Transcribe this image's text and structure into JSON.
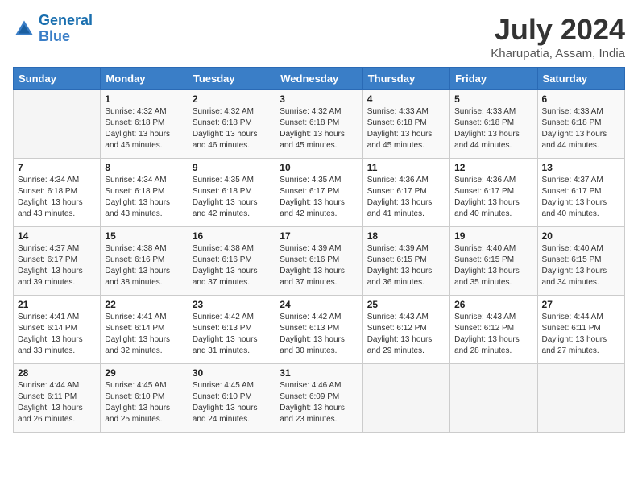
{
  "logo": {
    "line1": "General",
    "line2": "Blue"
  },
  "title": "July 2024",
  "location": "Kharupatia, Assam, India",
  "days_of_week": [
    "Sunday",
    "Monday",
    "Tuesday",
    "Wednesday",
    "Thursday",
    "Friday",
    "Saturday"
  ],
  "weeks": [
    [
      {
        "day": "",
        "sunrise": "",
        "sunset": "",
        "daylight": "",
        "empty": true
      },
      {
        "day": "1",
        "sunrise": "Sunrise: 4:32 AM",
        "sunset": "Sunset: 6:18 PM",
        "daylight": "Daylight: 13 hours and 46 minutes."
      },
      {
        "day": "2",
        "sunrise": "Sunrise: 4:32 AM",
        "sunset": "Sunset: 6:18 PM",
        "daylight": "Daylight: 13 hours and 46 minutes."
      },
      {
        "day": "3",
        "sunrise": "Sunrise: 4:32 AM",
        "sunset": "Sunset: 6:18 PM",
        "daylight": "Daylight: 13 hours and 45 minutes."
      },
      {
        "day": "4",
        "sunrise": "Sunrise: 4:33 AM",
        "sunset": "Sunset: 6:18 PM",
        "daylight": "Daylight: 13 hours and 45 minutes."
      },
      {
        "day": "5",
        "sunrise": "Sunrise: 4:33 AM",
        "sunset": "Sunset: 6:18 PM",
        "daylight": "Daylight: 13 hours and 44 minutes."
      },
      {
        "day": "6",
        "sunrise": "Sunrise: 4:33 AM",
        "sunset": "Sunset: 6:18 PM",
        "daylight": "Daylight: 13 hours and 44 minutes."
      }
    ],
    [
      {
        "day": "7",
        "sunrise": "Sunrise: 4:34 AM",
        "sunset": "Sunset: 6:18 PM",
        "daylight": "Daylight: 13 hours and 43 minutes."
      },
      {
        "day": "8",
        "sunrise": "Sunrise: 4:34 AM",
        "sunset": "Sunset: 6:18 PM",
        "daylight": "Daylight: 13 hours and 43 minutes."
      },
      {
        "day": "9",
        "sunrise": "Sunrise: 4:35 AM",
        "sunset": "Sunset: 6:18 PM",
        "daylight": "Daylight: 13 hours and 42 minutes."
      },
      {
        "day": "10",
        "sunrise": "Sunrise: 4:35 AM",
        "sunset": "Sunset: 6:17 PM",
        "daylight": "Daylight: 13 hours and 42 minutes."
      },
      {
        "day": "11",
        "sunrise": "Sunrise: 4:36 AM",
        "sunset": "Sunset: 6:17 PM",
        "daylight": "Daylight: 13 hours and 41 minutes."
      },
      {
        "day": "12",
        "sunrise": "Sunrise: 4:36 AM",
        "sunset": "Sunset: 6:17 PM",
        "daylight": "Daylight: 13 hours and 40 minutes."
      },
      {
        "day": "13",
        "sunrise": "Sunrise: 4:37 AM",
        "sunset": "Sunset: 6:17 PM",
        "daylight": "Daylight: 13 hours and 40 minutes."
      }
    ],
    [
      {
        "day": "14",
        "sunrise": "Sunrise: 4:37 AM",
        "sunset": "Sunset: 6:17 PM",
        "daylight": "Daylight: 13 hours and 39 minutes."
      },
      {
        "day": "15",
        "sunrise": "Sunrise: 4:38 AM",
        "sunset": "Sunset: 6:16 PM",
        "daylight": "Daylight: 13 hours and 38 minutes."
      },
      {
        "day": "16",
        "sunrise": "Sunrise: 4:38 AM",
        "sunset": "Sunset: 6:16 PM",
        "daylight": "Daylight: 13 hours and 37 minutes."
      },
      {
        "day": "17",
        "sunrise": "Sunrise: 4:39 AM",
        "sunset": "Sunset: 6:16 PM",
        "daylight": "Daylight: 13 hours and 37 minutes."
      },
      {
        "day": "18",
        "sunrise": "Sunrise: 4:39 AM",
        "sunset": "Sunset: 6:15 PM",
        "daylight": "Daylight: 13 hours and 36 minutes."
      },
      {
        "day": "19",
        "sunrise": "Sunrise: 4:40 AM",
        "sunset": "Sunset: 6:15 PM",
        "daylight": "Daylight: 13 hours and 35 minutes."
      },
      {
        "day": "20",
        "sunrise": "Sunrise: 4:40 AM",
        "sunset": "Sunset: 6:15 PM",
        "daylight": "Daylight: 13 hours and 34 minutes."
      }
    ],
    [
      {
        "day": "21",
        "sunrise": "Sunrise: 4:41 AM",
        "sunset": "Sunset: 6:14 PM",
        "daylight": "Daylight: 13 hours and 33 minutes."
      },
      {
        "day": "22",
        "sunrise": "Sunrise: 4:41 AM",
        "sunset": "Sunset: 6:14 PM",
        "daylight": "Daylight: 13 hours and 32 minutes."
      },
      {
        "day": "23",
        "sunrise": "Sunrise: 4:42 AM",
        "sunset": "Sunset: 6:13 PM",
        "daylight": "Daylight: 13 hours and 31 minutes."
      },
      {
        "day": "24",
        "sunrise": "Sunrise: 4:42 AM",
        "sunset": "Sunset: 6:13 PM",
        "daylight": "Daylight: 13 hours and 30 minutes."
      },
      {
        "day": "25",
        "sunrise": "Sunrise: 4:43 AM",
        "sunset": "Sunset: 6:12 PM",
        "daylight": "Daylight: 13 hours and 29 minutes."
      },
      {
        "day": "26",
        "sunrise": "Sunrise: 4:43 AM",
        "sunset": "Sunset: 6:12 PM",
        "daylight": "Daylight: 13 hours and 28 minutes."
      },
      {
        "day": "27",
        "sunrise": "Sunrise: 4:44 AM",
        "sunset": "Sunset: 6:11 PM",
        "daylight": "Daylight: 13 hours and 27 minutes."
      }
    ],
    [
      {
        "day": "28",
        "sunrise": "Sunrise: 4:44 AM",
        "sunset": "Sunset: 6:11 PM",
        "daylight": "Daylight: 13 hours and 26 minutes."
      },
      {
        "day": "29",
        "sunrise": "Sunrise: 4:45 AM",
        "sunset": "Sunset: 6:10 PM",
        "daylight": "Daylight: 13 hours and 25 minutes."
      },
      {
        "day": "30",
        "sunrise": "Sunrise: 4:45 AM",
        "sunset": "Sunset: 6:10 PM",
        "daylight": "Daylight: 13 hours and 24 minutes."
      },
      {
        "day": "31",
        "sunrise": "Sunrise: 4:46 AM",
        "sunset": "Sunset: 6:09 PM",
        "daylight": "Daylight: 13 hours and 23 minutes."
      },
      {
        "day": "",
        "sunrise": "",
        "sunset": "",
        "daylight": "",
        "empty": true
      },
      {
        "day": "",
        "sunrise": "",
        "sunset": "",
        "daylight": "",
        "empty": true
      },
      {
        "day": "",
        "sunrise": "",
        "sunset": "",
        "daylight": "",
        "empty": true
      }
    ]
  ]
}
